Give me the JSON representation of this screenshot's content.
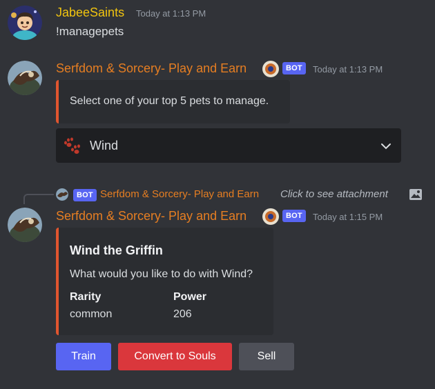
{
  "messages": [
    {
      "username": "JabeeSaints",
      "timestamp": "Today at 1:13 PM",
      "text": "!managepets"
    },
    {
      "username": "Serfdom & Sorcery- Play and Earn",
      "bot_tag": "BOT",
      "timestamp": "Today at 1:13 PM",
      "embed_text": "Select one of your top 5 pets to manage.",
      "select": {
        "selected": "Wind",
        "icon": "paw-prints-icon"
      }
    },
    {
      "reply": {
        "bot_tag": "BOT",
        "username": "Serfdom & Sorcery- Play and Earn",
        "text": "Click to see attachment"
      },
      "username": "Serfdom & Sorcery- Play and Earn",
      "bot_tag": "BOT",
      "timestamp": "Today at 1:15 PM",
      "embed": {
        "title": "Wind the Griffin",
        "description": "What would you like to do with Wind?",
        "fields": [
          {
            "name": "Rarity",
            "value": "common"
          },
          {
            "name": "Power",
            "value": "206"
          }
        ]
      },
      "buttons": [
        {
          "label": "Train",
          "style": "primary"
        },
        {
          "label": "Convert to Souls",
          "style": "danger"
        },
        {
          "label": "Sell",
          "style": "secondary"
        }
      ]
    }
  ],
  "colors": {
    "background": "#313338",
    "embed_accent": "#e0552f",
    "primary": "#5865f2",
    "danger": "#da373c",
    "secondary": "#4e5058",
    "user_name": "#f1c40f",
    "bot_name": "#e67e22"
  }
}
